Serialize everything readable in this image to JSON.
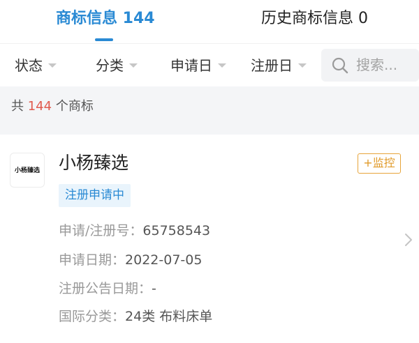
{
  "tabs": [
    {
      "label": "商标信息 144"
    },
    {
      "label": "历史商标信息 0"
    }
  ],
  "filters": [
    {
      "label": "状态"
    },
    {
      "label": "分类"
    },
    {
      "label": "申请日"
    },
    {
      "label": "注册日"
    }
  ],
  "search": {
    "placeholder": "搜索..."
  },
  "summary": {
    "prefix": "共",
    "count": "144",
    "suffix": "个商标"
  },
  "trademark": {
    "logo_text": "小杨臻选",
    "name": "小杨臻选",
    "monitor_label": "+监控",
    "status": "注册申请中",
    "fields": [
      {
        "label": "申请/注册号：",
        "value": "65758543"
      },
      {
        "label": "申请日期：",
        "value": "2022-07-05"
      },
      {
        "label": "注册公告日期：",
        "value": "-"
      },
      {
        "label": "国际分类：",
        "value": "24类 布料床单"
      }
    ]
  },
  "colors": {
    "accent": "#2a8ad4",
    "count_highlight": "#e05a4e",
    "monitor_border": "#e7a43a",
    "status_bg": "#e9f4fc"
  },
  "icons": [
    "search-icon",
    "caret-down-icon",
    "chevron-right-icon"
  ]
}
